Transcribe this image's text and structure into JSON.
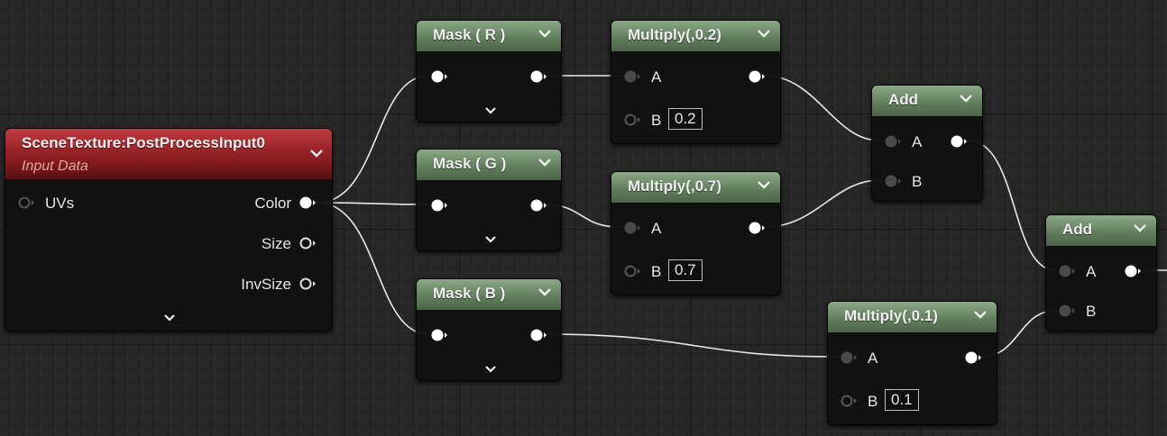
{
  "nodes": {
    "scene_texture": {
      "title": "SceneTexture:PostProcessInput0",
      "subtitle": "Input Data",
      "inputs": [
        "UVs"
      ],
      "outputs": [
        "Color",
        "Size",
        "InvSize"
      ]
    },
    "mask_r": {
      "title": "Mask ( R )"
    },
    "mask_g": {
      "title": "Mask ( G )"
    },
    "mask_b": {
      "title": "Mask ( B )"
    },
    "multiply_02": {
      "title": "Multiply(,0.2)",
      "pin_a": "A",
      "pin_b": "B",
      "value_b": "0.2"
    },
    "multiply_07": {
      "title": "Multiply(,0.7)",
      "pin_a": "A",
      "pin_b": "B",
      "value_b": "0.7"
    },
    "multiply_01": {
      "title": "Multiply(,0.1)",
      "pin_a": "A",
      "pin_b": "B",
      "value_b": "0.1"
    },
    "add_1": {
      "title": "Add",
      "pin_a": "A",
      "pin_b": "B"
    },
    "add_2": {
      "title": "Add",
      "pin_a": "A",
      "pin_b": "B"
    }
  },
  "colors": {
    "background": "#262626",
    "grid_minor": "#2d2d2d",
    "grid_major": "#1a1a1a",
    "header_math": "#62805d",
    "header_scene_texture": "#8a1c1f",
    "wire": "#e6e6e6",
    "pin_connected": "#ffffff",
    "pin_unconnected": "#4a4a4a"
  }
}
